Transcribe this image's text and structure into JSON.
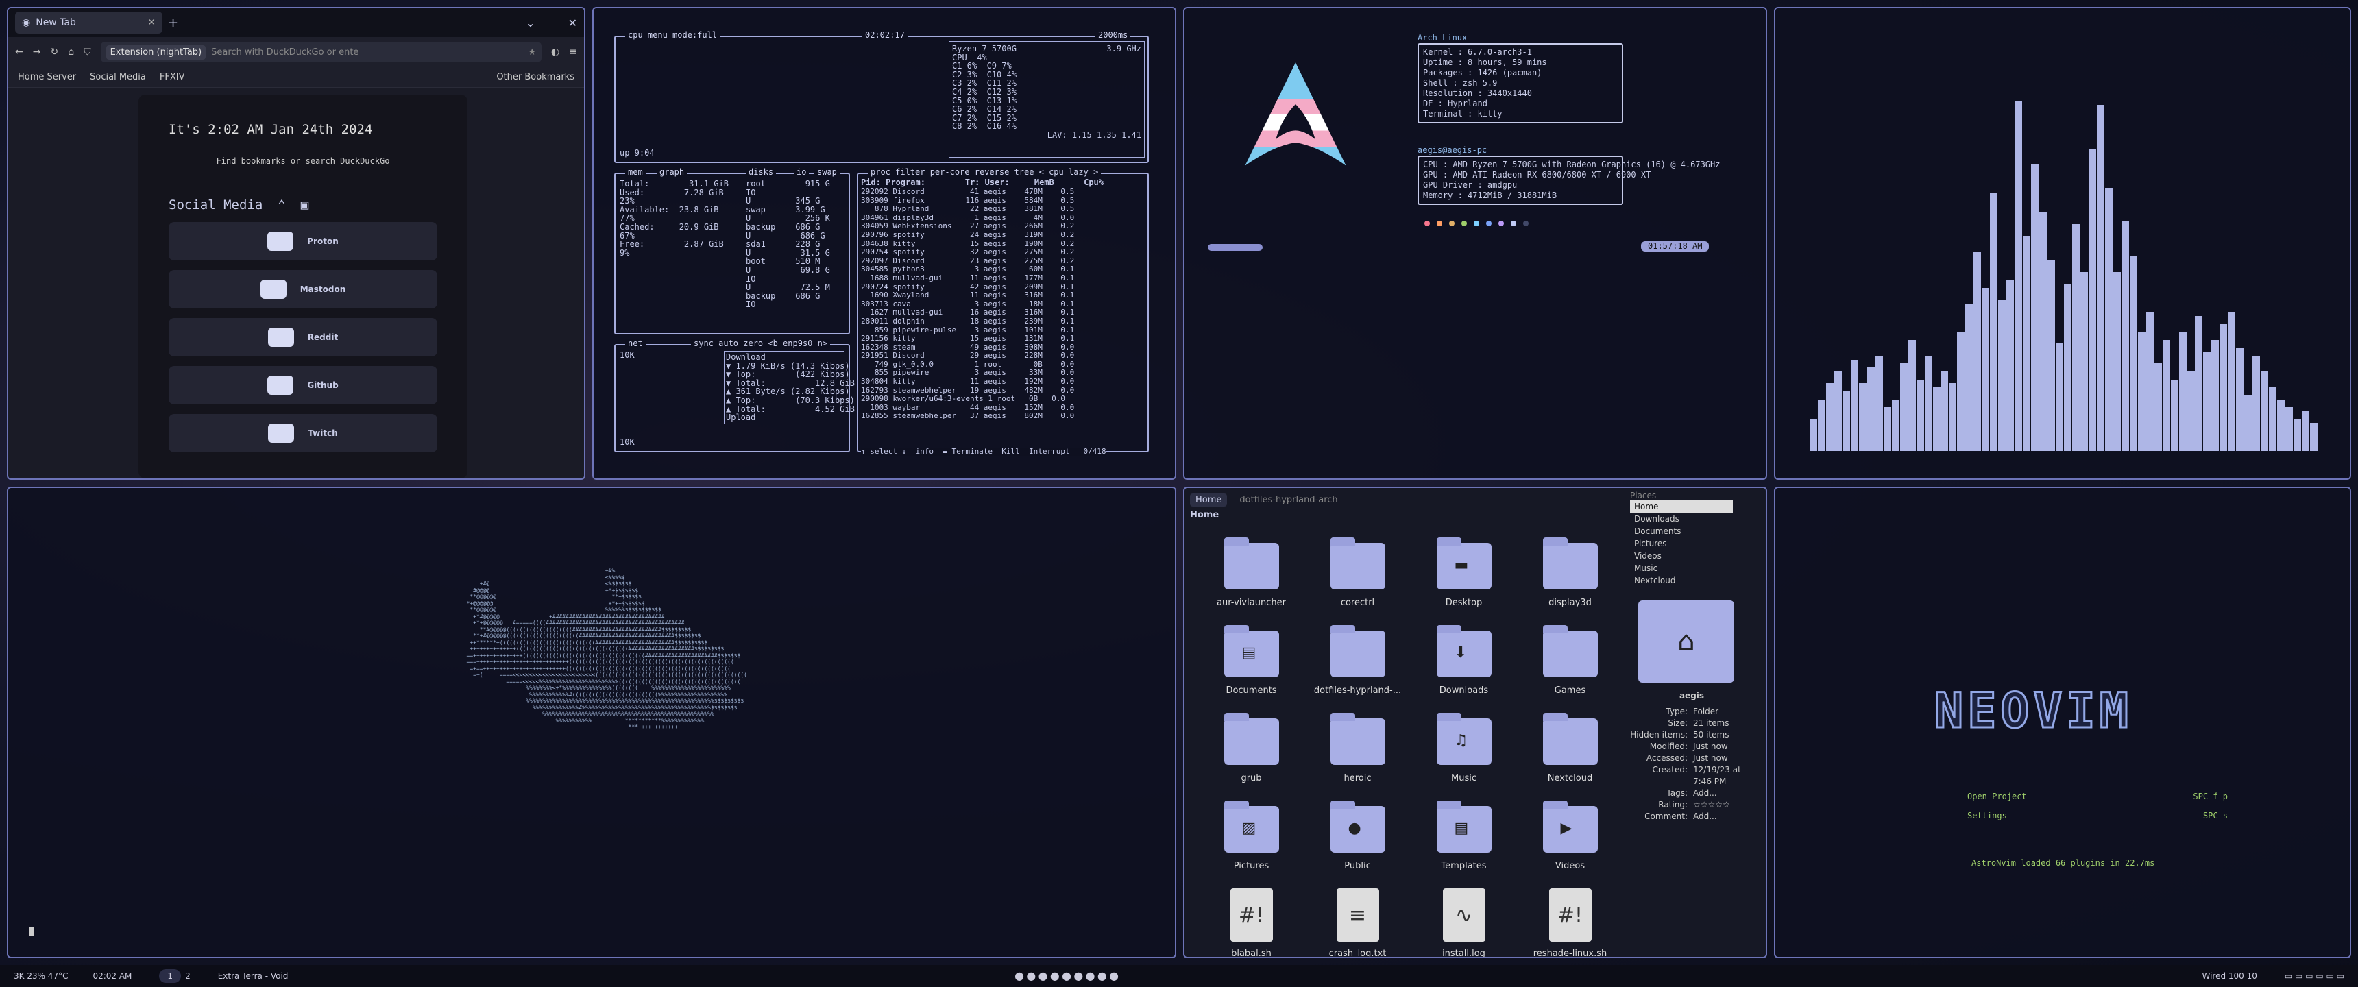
{
  "firefox": {
    "tab_label": "New Tab",
    "new_tab": "+",
    "ext_label": "Extension (nightTab)",
    "search_placeholder": "Search with DuckDuckGo or ente",
    "bookmarks": [
      "Home Server",
      "Social Media",
      "FFXIV"
    ],
    "other_bookmarks": "Other Bookmarks",
    "clock": "It's 2:02 AM Jan 24th 2024",
    "find_text": "Find bookmarks or search DuckDuckGo",
    "section": "Social Media",
    "links": [
      "Proton",
      "Mastodon",
      "Reddit",
      "Github",
      "Twitch"
    ]
  },
  "btop": {
    "header": "cpu  menu  mode:full",
    "clock": "02:02:17",
    "refresh": "2000ms",
    "cpu_model": "Ryzen 7 5700G",
    "freq": "3.9 GHz",
    "cpu_rows": [
      "CPU  4%",
      "C1 6%  C9 7%",
      "C2 3%  C10 4%",
      "C3 2%  C11 2%",
      "C4 2%  C12 3%",
      "C5 0%  C13 1%",
      "C6 2%  C14 2%",
      "C7 2%  C15 2%",
      "C8 2%  C16 4%"
    ],
    "lav": "LAV: 1.15 1.35 1.41",
    "uptime": "up 9:04",
    "mem_title": "mem",
    "mem_graph": "graph",
    "disks_title": "disks",
    "io": "io",
    "swap": "swap",
    "mem_rows": [
      "Total:        31.1 GiB",
      "Used:        7.28 GiB",
      "23%",
      "Available:  23.8 GiB",
      "77%",
      "Cached:     20.9 GiB",
      "67%",
      "Free:        2.87 GiB",
      "9%"
    ],
    "disk_rows": [
      "root        915 G",
      "IO",
      "U         345 G",
      "swap      3.99 G",
      "U           256 K",
      "backup    686 G",
      "U          686 G",
      "sda1      228 G",
      "U          31.5 G",
      "boot      510 M",
      "U          69.8 G",
      "IO",
      "U          72.5 M",
      "backup    686 G",
      "IO"
    ],
    "net_title": "net",
    "net_opts": "sync  auto  zero  <b enp9s0 n>",
    "net_scale_top": "10K",
    "net_scale_bot": "10K",
    "net_rows": [
      "Download",
      "▼ 1.79 KiB/s (14.3 Kibps)",
      "▼ Top:        (422 Kibps)",
      "▼ Total:          12.8 GiB",
      "▲ 361 Byte/s (2.82 Kibps)",
      "▲ Top:        (70.3 Kibps)",
      "▲ Total:          4.52 GiB",
      "Upload"
    ],
    "proc_title": "proc  filter  per-core  reverse  tree  < cpu lazy >",
    "proc_header": "Pid: Program:        Tr: User:     MemB      Cpu%",
    "procs": [
      "292092 Discord          41 aegis    478M    0.5",
      "303909 firefox         116 aegis    584M    0.5",
      "   878 Hyprland         22 aegis    381M    0.5",
      "304961 display3d         1 aegis      4M    0.0",
      "304059 WebExtensions    27 aegis    266M    0.2",
      "290796 spotify          24 aegis    319M    0.2",
      "304638 kitty            15 aegis    190M    0.2",
      "290754 spotify          32 aegis    275M    0.2",
      "292097 Discord          23 aegis    275M    0.2",
      "304585 python3           3 aegis     60M    0.1",
      "  1688 mullvad-gui      11 aegis    177M    0.1",
      "290724 spotify          42 aegis    209M    0.1",
      "  1690 Xwayland         11 aegis    316M    0.1",
      "303713 cava              3 aegis     18M    0.1",
      "  1627 mullvad-gui      16 aegis    316M    0.1",
      "280011 dolphin          18 aegis    239M    0.1",
      "   859 pipewire-pulse    3 aegis    101M    0.1",
      "291156 kitty            15 aegis    131M    0.1",
      "162348 steam            49 aegis    308M    0.0",
      "291951 Discord          29 aegis    228M    0.0",
      "   749 gtk_0.0.0         1 root       0B    0.0",
      "   855 pipewire          3 aegis     33M    0.0",
      "304804 kitty            11 aegis    192M    0.0",
      "162793 steamwebhelper   19 aegis    482M    0.0",
      "290098 kworker/u64:3-events 1 root   0B   0.0",
      "  1003 waybar           44 aegis    152M    0.0",
      "162855 steamwebhelper   37 aegis    802M    0.0"
    ],
    "proc_footer": "↑ select ↓  info  ≡ Terminate  Kill  Interrupt   0/418"
  },
  "fetch": {
    "title": "Arch Linux",
    "lines": [
      "Kernel : 6.7.0-arch3-1",
      "Uptime : 8 hours, 59 mins",
      "Packages : 1426 (pacman)",
      "Shell : zsh 5.9",
      "Resolution : 3440x1440",
      "DE : Hyprland",
      "Terminal : kitty"
    ],
    "user": "aegis@aegis-pc",
    "hw": [
      "CPU : AMD Ryzen 7 5700G with Radeon Graphics (16) @ 4.673GHz",
      "GPU : AMD ATI Radeon RX 6800/6800 XT / 6900 XT",
      "GPU Driver : amdgpu",
      "Memory : 4712MiB / 31881MiB"
    ],
    "time": "01:57:18 AM",
    "palette": [
      "#f7768e",
      "#ff9e64",
      "#e0af68",
      "#9ece6a",
      "#7dcfff",
      "#7aa2f7",
      "#bb9af7",
      "#c0caf5",
      "#414868"
    ]
  },
  "cava": {
    "levels": [
      0.08,
      0.13,
      0.17,
      0.2,
      0.15,
      0.23,
      0.17,
      0.21,
      0.24,
      0.11,
      0.13,
      0.22,
      0.28,
      0.18,
      0.24,
      0.16,
      0.2,
      0.17,
      0.3,
      0.37,
      0.5,
      0.41,
      0.65,
      0.38,
      0.43,
      0.88,
      0.54,
      0.72,
      0.6,
      0.48,
      0.27,
      0.42,
      0.57,
      0.45,
      0.76,
      0.87,
      0.66,
      0.45,
      0.58,
      0.49,
      0.3,
      0.35,
      0.22,
      0.28,
      0.18,
      0.3,
      0.2,
      0.34,
      0.25,
      0.28,
      0.32,
      0.35,
      0.26,
      0.14,
      0.24,
      0.2,
      0.16,
      0.13,
      0.11,
      0.08,
      0.1,
      0.07
    ],
    "color": "#aeb6e6"
  },
  "whale": {
    "art": [
      "                                                  +#%",
      "                                                  <%%%%$",
      "            +#@                                   <%$$$$$$",
      "          #@@@@                                   +*+$$$$$$$",
      "         **@@@@@@                                   **+$$$$$$",
      "        *+@@@@@@                                   +*++$$$$$$$",
      "         **@@@@@@                                 %%%%%%$$$$$$$$$$$",
      "          +*#@@@@@               +##################################",
      "          +*+@@@@@@   #=====((((##########################################",
      "            **#@@@@@((((((((((((((((((((###########################$$$$$$$$$",
      "          **+#@@@@@@((((((((((((((((((((((#############################$$$$$$$$",
      "         ++******+(((((((((((((((((((((((((((((########################$$$$$$$$$$",
      "         ++++++++++++++((((((((((((((((((((((((((((((((((####################$$$$$$$$$",
      "        ==+++++++++++++++(((((((((((((((((((((((((((((((((((((######################$$$$$$$",
      "        ===++++++++++++++++++++++++++++((((((((((((((((((((((((((((((((((((((((((((((((((",
      "         =+==+++++++++++++++++++++++++((((((((((((((((((((((((((((((((((((((((((((((((((",
      "          =+(     ====<<<<<<<<<<<<<<<<<<<<<<<<<((((((((((((((((((((((((((((((((((((((((((((((",
      "                    =====<<<<<%%%%%%%%%%%%%%%%%%%%%%%%(((((((((((((((((((((((((((((((((((((",
      "                          %%%%%%%%<+*%%%%%%%%%%%%%%%((((((((    %%%%%%%%%%%%%%%%%%%%%%%%",
      "                           %%%%%%%%%%%%#((((((((((((((((((((((((((%%%%%%%%%%%%%%%%%%%%%",
      "                          %%%%%%%%%%%%%%%%%%%%%%%%%%%%%%%%%%%%%%%%%%%%%%%%%%%%%%%%%$$$$$$$$$",
      "                            %%%%%%%%%%%%%%#%%%%%%%%%%%%%%%%%%%%%%%%%%%%%%%%%%%%%%%$$$$$$$$",
      "                               %%%%%%%%%%%%%%%%%%%%%%%%%%%%%%%%%%%%%%%%%%%%%%%%%%%%",
      "                                   %%%%%%%%%%%          ***********%%%%%%%%%%%%%",
      "                                                         ***++++++++++++"
    ]
  },
  "files": {
    "tabs": [
      "Home",
      "dotfiles-hyprland-arch"
    ],
    "location": "Home",
    "items": [
      {
        "name": "aur-vivlauncher",
        "icon": ""
      },
      {
        "name": "corectrl",
        "icon": ""
      },
      {
        "name": "Desktop",
        "icon": "▬"
      },
      {
        "name": "display3d",
        "icon": ""
      },
      {
        "name": "Documents",
        "icon": "▤"
      },
      {
        "name": "dotfiles-hyprland-...",
        "icon": ""
      },
      {
        "name": "Downloads",
        "icon": "⬇"
      },
      {
        "name": "Games",
        "icon": ""
      },
      {
        "name": "grub",
        "icon": ""
      },
      {
        "name": "heroic",
        "icon": ""
      },
      {
        "name": "Music",
        "icon": "♫"
      },
      {
        "name": "Nextcloud",
        "icon": ""
      },
      {
        "name": "Pictures",
        "icon": "▨"
      },
      {
        "name": "Public",
        "icon": "●"
      },
      {
        "name": "Templates",
        "icon": "▤"
      },
      {
        "name": "Videos",
        "icon": "▶"
      },
      {
        "name": "blabal.sh",
        "icon": "#!",
        "doc": true
      },
      {
        "name": "crash_log.txt",
        "icon": "≡",
        "doc": true
      },
      {
        "name": "install.log",
        "icon": "∿",
        "doc": true
      },
      {
        "name": "reshade-linux.sh",
        "icon": "#!",
        "doc": true
      }
    ],
    "places_title": "Places",
    "places": [
      "Home",
      "Downloads",
      "Documents",
      "Pictures",
      "Videos",
      "Music",
      "Nextcloud"
    ],
    "info_name": "aegis",
    "info": [
      [
        "Type:",
        "Folder"
      ],
      [
        "Size:",
        "21 items"
      ],
      [
        "Hidden items:",
        "50 items"
      ],
      [
        "Modified:",
        "Just now"
      ],
      [
        "Accessed:",
        "Just now"
      ],
      [
        "Created:",
        "12/19/23 at 7:46 PM"
      ],
      [
        "Tags:",
        "Add..."
      ],
      [
        "Rating:",
        "☆☆☆☆☆"
      ],
      [
        "Comment:",
        "Add..."
      ]
    ]
  },
  "nvim": {
    "logo": "NEOVIM",
    "menu": [
      [
        "Open Project",
        "SPC f p"
      ],
      [
        "Settings",
        "SPC s"
      ]
    ],
    "status": "AstroNvim loaded 66 plugins  in 22.7ms"
  },
  "bar": {
    "left": "3K  23%  47°C",
    "clock": "02:02 AM",
    "ws": [
      "1",
      "2"
    ],
    "title": "Extra Terra - Void",
    "right": "Wired  100  10"
  }
}
